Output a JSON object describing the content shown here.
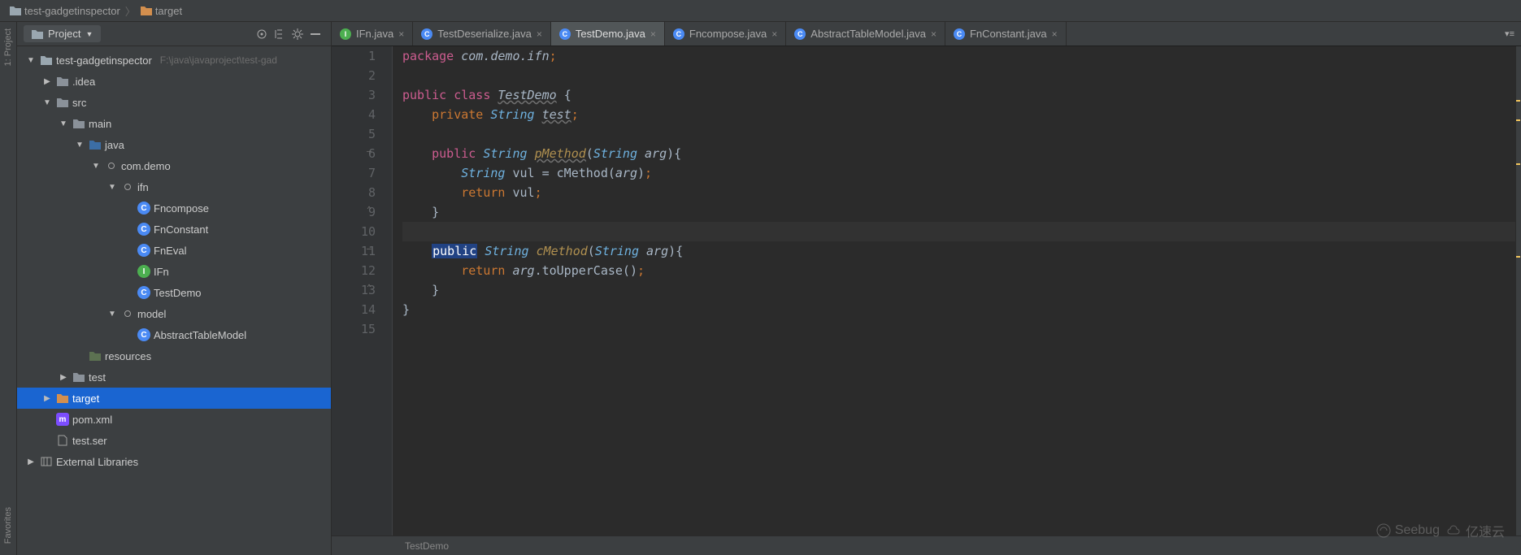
{
  "breadcrumb": [
    {
      "label": "test-gadgetinspector",
      "icon": "folder",
      "color": "#b8c4cc"
    },
    {
      "label": "target",
      "icon": "folder",
      "color": "#d38f4e"
    }
  ],
  "sidebar": {
    "selector_label": "Project",
    "root": {
      "label": "test-gadgetinspector",
      "path": "F:\\java\\javaproject\\test-gad"
    },
    "tree": [
      {
        "d": 0,
        "expand": "down",
        "icon": "module",
        "label": "test-gadgetinspector",
        "suffix": "F:\\java\\javaproject\\test-gad",
        "name": "root"
      },
      {
        "d": 1,
        "expand": "right",
        "icon": "folder",
        "label": ".idea",
        "name": "idea"
      },
      {
        "d": 1,
        "expand": "down",
        "icon": "folder",
        "label": "src",
        "name": "src"
      },
      {
        "d": 2,
        "expand": "down",
        "icon": "folder",
        "label": "main",
        "name": "main"
      },
      {
        "d": 3,
        "expand": "down",
        "icon": "folder-src",
        "label": "java",
        "name": "java"
      },
      {
        "d": 4,
        "expand": "down",
        "icon": "package",
        "label": "com.demo",
        "name": "pkg-com-demo"
      },
      {
        "d": 5,
        "expand": "down",
        "icon": "package",
        "label": "ifn",
        "name": "pkg-ifn"
      },
      {
        "d": 6,
        "expand": "",
        "icon": "class",
        "label": "Fncompose",
        "name": "class-fncompose"
      },
      {
        "d": 6,
        "expand": "",
        "icon": "class",
        "label": "FnConstant",
        "name": "class-fnconstant"
      },
      {
        "d": 6,
        "expand": "",
        "icon": "class",
        "label": "FnEval",
        "name": "class-fneval"
      },
      {
        "d": 6,
        "expand": "",
        "icon": "interface",
        "label": "IFn",
        "name": "class-ifn"
      },
      {
        "d": 6,
        "expand": "",
        "icon": "class",
        "label": "TestDemo",
        "name": "class-testdemo"
      },
      {
        "d": 5,
        "expand": "down",
        "icon": "package",
        "label": "model",
        "name": "pkg-model"
      },
      {
        "d": 6,
        "expand": "",
        "icon": "class",
        "label": "AbstractTableModel",
        "name": "class-abstracttablemodel"
      },
      {
        "d": 3,
        "expand": "",
        "icon": "folder-res",
        "label": "resources",
        "name": "resources"
      },
      {
        "d": 2,
        "expand": "right",
        "icon": "folder",
        "label": "test",
        "name": "test"
      },
      {
        "d": 1,
        "expand": "right",
        "icon": "folder-o",
        "label": "target",
        "name": "target",
        "selected": true
      },
      {
        "d": 1,
        "expand": "",
        "icon": "maven",
        "label": "pom.xml",
        "name": "pom"
      },
      {
        "d": 1,
        "expand": "",
        "icon": "file",
        "label": "test.ser",
        "name": "test-ser"
      },
      {
        "d": 0,
        "expand": "right",
        "icon": "lib",
        "label": "External Libraries",
        "name": "extlib"
      }
    ]
  },
  "tabs": [
    {
      "label": "IFn.java",
      "icon": "interface",
      "active": false
    },
    {
      "label": "TestDeserialize.java",
      "icon": "class",
      "active": false
    },
    {
      "label": "TestDemo.java",
      "icon": "class",
      "active": true
    },
    {
      "label": "Fncompose.java",
      "icon": "class",
      "active": false
    },
    {
      "label": "AbstractTableModel.java",
      "icon": "class",
      "active": false
    },
    {
      "label": "FnConstant.java",
      "icon": "class",
      "active": false
    }
  ],
  "code": {
    "lines": [
      {
        "n": 1,
        "html": "<span class='kwpub'>package</span> <span class='pkg'>com.demo.ifn</span><span class='semi'>;</span>"
      },
      {
        "n": 2,
        "html": ""
      },
      {
        "n": 3,
        "html": "<span class='kwpub'>public</span> <span class='kwpub'>class</span> <span class='classname'>TestDemo</span> <span class='paren'>{</span>"
      },
      {
        "n": 4,
        "html": "    <span class='kw'>private</span> <span class='str-type'>String</span> <span class='field-u'>test</span><span class='semi'>;</span>"
      },
      {
        "n": 5,
        "html": ""
      },
      {
        "n": 6,
        "html": "    <span class='kwpub'>public</span> <span class='str-type'>String</span> <span class='method-u'>pMethod</span><span class='paren'>(</span><span class='str-type'>String</span> <span class='param'>arg</span><span class='paren'>){</span>",
        "mark": "–"
      },
      {
        "n": 7,
        "html": "        <span class='str-type'>String</span> <span class='ident'>vul</span> <span class='eq'>=</span> <span class='call'>cMethod(</span><span class='param'>arg</span><span class='call'>)</span><span class='semi'>;</span>"
      },
      {
        "n": 8,
        "html": "        <span class='kw'>return</span> <span class='ident'>vul</span><span class='semi'>;</span>"
      },
      {
        "n": 9,
        "html": "    <span class='paren'>}</span>",
        "mark": "⌃"
      },
      {
        "n": 10,
        "html": "",
        "cursor": true
      },
      {
        "n": 11,
        "html": "    <span class='kwpub' style='background:#214283;color:#fff;padding:0 1px'>public</span> <span class='str-type'>String</span> <span class='method'>cMethod</span><span class='paren'>(</span><span class='str-type'>String</span> <span class='param'>arg</span><span class='paren'>){</span>",
        "mark": "–"
      },
      {
        "n": 12,
        "html": "        <span class='kw'>return</span> <span class='param'>arg</span><span class='ident'>.</span><span class='call'>toUpperCase()</span><span class='semi'>;</span>"
      },
      {
        "n": 13,
        "html": "    <span class='paren'>}</span>",
        "mark": "⌃"
      },
      {
        "n": 14,
        "html": "<span class='paren'>}</span>"
      },
      {
        "n": 15,
        "html": ""
      }
    ]
  },
  "status": {
    "breadcrumb": "TestDemo"
  },
  "left_rail": [
    {
      "label": "1: Project"
    },
    {
      "label": "Favorites"
    }
  ],
  "watermark_brands": [
    "Seebug",
    "亿速云"
  ]
}
